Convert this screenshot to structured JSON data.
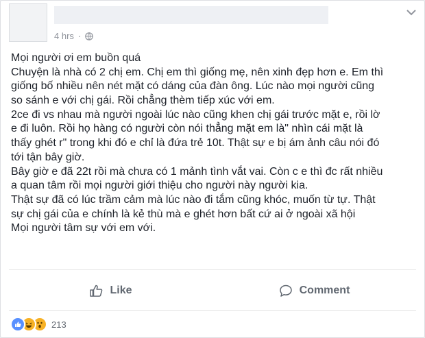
{
  "post": {
    "timestamp": "4 hrs",
    "separator": "·",
    "lines": [
      "Mọi người ơi em buồn quá",
      "Chuyện là nhà có 2 chị em. Chị em thì giống mẹ, nên xinh đẹp hơn e. Em thì",
      "giống bố nhiều nên nét mặt có dáng của đàn ông. Lúc nào mọi người cũng",
      "so sánh e với chị gái. Rồi chẳng thèm tiếp xúc với em.",
      "2ce đi vs nhau mà người ngoài lúc nào cũng khen chị gái trước mặt e, rồi lờ",
      "e đi luôn. Rồi họ hàng có người còn nói thẳng mặt em là\" nhìn cái mặt là",
      "thấy ghét r\" trong khi đó e chỉ là đứa trẻ 10t. Thật sự e bị ám ảnh câu nói đó",
      "tới tận bây giờ.",
      "Bây giờ e đã 22t rồi mà chưa có 1 mảnh tình vắt vai. Còn c e thì đc rất nhiều",
      "a quan tâm rồi mọi người giới thiệu cho người này người kia.",
      "Thật sự đã có lúc trầm cảm mà lúc nào đi tắm cũng khóc, muốn từ tự. Thật",
      "sự chị gái của e chính là kẻ thù mà e ghét hơn bất cứ ai ở ngoài xã hội",
      "Mọi người tâm sự với em với."
    ]
  },
  "actions": {
    "like_label": "Like",
    "comment_label": "Comment"
  },
  "reactions": {
    "types": [
      "like",
      "haha",
      "wow"
    ],
    "count": "213"
  },
  "icons": {
    "like": "thumbs-up-icon",
    "comment": "speech-bubble-icon",
    "privacy": "globe-icon",
    "menu": "chevron-down-icon"
  },
  "colors": {
    "text": "#1d2129",
    "meta": "#90949c",
    "action": "#606770",
    "like_reaction": "#5890ff",
    "emoji_reaction": "#f7b125"
  }
}
